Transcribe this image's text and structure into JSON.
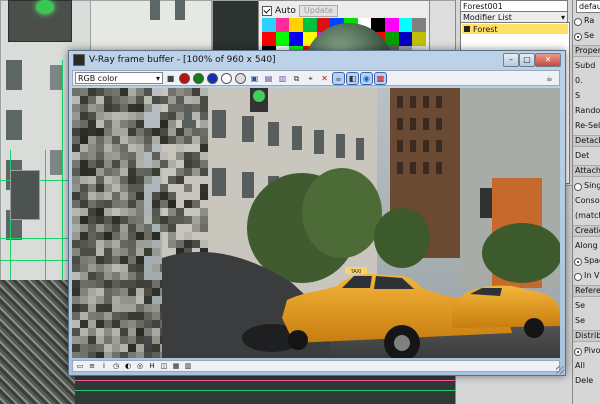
{
  "material_editor": {
    "auto_label": "Auto",
    "auto_checked": true,
    "update_label": "Update",
    "swatch_colors": [
      "#2bd0ff",
      "#ff2b9a",
      "#ffd200",
      "#00c040",
      "#e01010",
      "#0044ff",
      "#00e000",
      "#ffffff",
      "#000000",
      "#ff00ff",
      "#00ffff",
      "#808080",
      "#ff0000",
      "#00ff00",
      "#0000ff",
      "#ffff00",
      "#ff00ff",
      "#00ffff",
      "#000000",
      "#ffffff",
      "#ff0000",
      "#00a000",
      "#0000c0",
      "#c0c000",
      "#000000",
      "#ffffff",
      "#00ff00",
      "#ff0000",
      "#0000ff",
      "#000000",
      "#ffffff",
      "#202020",
      "#404040",
      "#606060",
      "#a0a0a0",
      "#e0e0e0"
    ]
  },
  "command_panel": {
    "object_name": "Forest001",
    "name_field_right": "default",
    "modifier_list_label": "Modifier List",
    "stack_item": "Forest",
    "right_column": {
      "labels": [
        "Ra",
        "Se",
        "Properties",
        "Subd",
        "0.",
        "S",
        "Random",
        "Re-Sele",
        "Detach",
        "Det",
        "Attach",
        "Single",
        "Consol",
        "(match",
        "Creation",
        "Along a",
        "Spac",
        "In Vi",
        "Reference",
        "Se",
        "Se",
        "Distribut",
        "Pivot",
        "All",
        "Dele"
      ]
    }
  },
  "vfb": {
    "title": "V-Ray frame buffer - [100% of 960 x 540]",
    "window_controls": [
      "–",
      "□",
      "✕"
    ],
    "channel_select": "RGB color",
    "toolbar_icons": [
      {
        "name": "save-icon",
        "color": "#444",
        "glyph": "■",
        "shape": "square"
      },
      {
        "name": "red-channel-icon",
        "color": "#c01010",
        "glyph": "",
        "shape": "circle"
      },
      {
        "name": "green-channel-icon",
        "color": "#108010",
        "glyph": "",
        "shape": "circle"
      },
      {
        "name": "blue-channel-icon",
        "color": "#1030b0",
        "glyph": "",
        "shape": "circle"
      },
      {
        "name": "alpha-channel-icon",
        "color": "#ffffff",
        "glyph": "",
        "shape": "circle"
      },
      {
        "name": "mono-icon",
        "color": "#dddddd",
        "glyph": "",
        "shape": "circle"
      },
      {
        "name": "save-image-icon",
        "color": "#2a4e9a",
        "glyph": "▣",
        "shape": "square"
      },
      {
        "name": "load-image-icon",
        "color": "#5b3a90",
        "glyph": "▤",
        "shape": "square"
      },
      {
        "name": "clear-image-icon",
        "color": "#7a4ab0",
        "glyph": "▥",
        "shape": "square"
      },
      {
        "name": "duplicate-icon",
        "color": "#444",
        "glyph": "⧉",
        "shape": "square"
      },
      {
        "name": "track-mouse-icon",
        "color": "#333",
        "glyph": "⌖",
        "shape": "square"
      },
      {
        "name": "delete-icon",
        "color": "#d01010",
        "glyph": "✕",
        "shape": "square"
      },
      {
        "name": "teapot-icon",
        "color": "#333",
        "glyph": "☕",
        "shape": "square"
      },
      {
        "name": "region-icon",
        "color": "#333",
        "glyph": "◧",
        "shape": "square"
      },
      {
        "name": "lens-effects-icon",
        "color": "#0b6fc0",
        "glyph": "◉",
        "shape": "square"
      },
      {
        "name": "lut-icon",
        "color": "#c02020",
        "glyph": "▩",
        "shape": "square"
      }
    ],
    "right_icon": "teapot-icon",
    "status_icons": [
      "ui-icon",
      "list-icon",
      "info-icon",
      "history-icon",
      "color-corrections-icon",
      "display-icon",
      "h-icon",
      "stereo-icon",
      "lut-icon",
      "pixel-aspect-icon"
    ],
    "render": {
      "taxi_sign": "TAXI"
    }
  }
}
